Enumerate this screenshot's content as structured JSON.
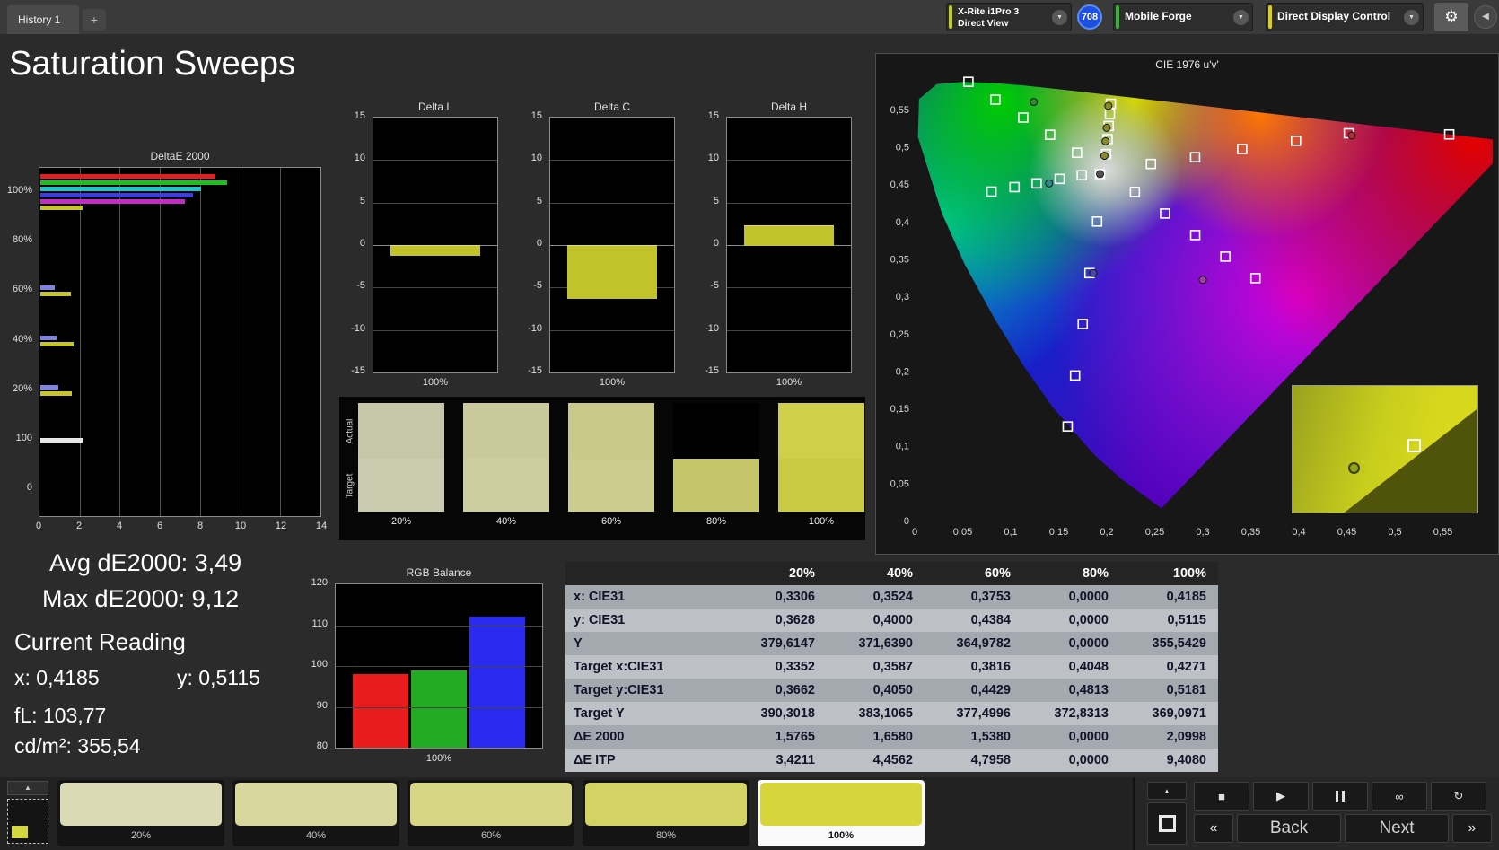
{
  "topbar": {
    "history_tab": "History 1",
    "add_tab": "+",
    "meter_line1": "X-Rite i1Pro 3",
    "meter_line2": "Direct View",
    "badge": "708",
    "source": "Mobile Forge",
    "control": "Direct Display Control"
  },
  "icons": {
    "chevron_down": "▼",
    "gear": "⚙",
    "collapse_left": "◀",
    "up": "▲",
    "stop": "■",
    "play": "▶",
    "infinity": "∞",
    "loop": "↻",
    "prev": "«",
    "next": "»"
  },
  "colors": {
    "meter_accent": "#bed41c",
    "source_accent": "#35b435",
    "control_accent": "#e0d00a"
  },
  "title": "Saturation Sweeps",
  "stats": {
    "avg": "Avg dE2000: 3,49",
    "max": "Max dE2000: 9,12",
    "current_heading": "Current Reading",
    "x": "x: 0,4185",
    "y": "y: 0,5115",
    "fl": "fL: 103,77",
    "cd": "cd/m²: 355,54"
  },
  "charts": {
    "deltae": {
      "title": "DeltaE 2000",
      "x_ticks": [
        "0",
        "2",
        "4",
        "6",
        "8",
        "10",
        "12",
        "14"
      ],
      "x_max": 14,
      "groups": [
        {
          "label": "100%",
          "bars": [
            {
              "color": "#e02020",
              "value": 8.7
            },
            {
              "color": "#1fbf1f",
              "value": 9.3
            },
            {
              "color": "#20c6c6",
              "value": 8.0
            },
            {
              "color": "#3d3de0",
              "value": 7.6
            },
            {
              "color": "#c42ac4",
              "value": 7.2
            },
            {
              "color": "#c6c62a",
              "value": 2.1
            }
          ]
        },
        {
          "label": "80%",
          "bars": []
        },
        {
          "label": "60%",
          "bars": [
            {
              "color": "#8282e6",
              "value": 0.7
            },
            {
              "color": "#c6c62a",
              "value": 1.54
            }
          ]
        },
        {
          "label": "40%",
          "bars": [
            {
              "color": "#8282e6",
              "value": 0.8
            },
            {
              "color": "#c6c62a",
              "value": 1.66
            }
          ]
        },
        {
          "label": "20%",
          "bars": [
            {
              "color": "#8282e6",
              "value": 0.9
            },
            {
              "color": "#c6c62a",
              "value": 1.58
            }
          ]
        },
        {
          "label": "100",
          "bars": [
            {
              "color": "#e8e8e8",
              "value": 2.1
            }
          ]
        },
        {
          "label": "0",
          "bars": []
        }
      ]
    },
    "delta_l": {
      "title": "Delta L",
      "y_ticks": [
        15,
        10,
        5,
        0,
        -5,
        -10,
        -15
      ],
      "x_label": "100%",
      "value": -1.2
    },
    "delta_c": {
      "title": "Delta C",
      "y_ticks": [
        15,
        10,
        5,
        0,
        -5,
        -10,
        -15
      ],
      "x_label": "100%",
      "value": -6.2
    },
    "delta_h": {
      "title": "Delta H",
      "y_ticks": [
        15,
        10,
        5,
        0,
        -5,
        -10,
        -15
      ],
      "x_label": "100%",
      "value": 2.3
    },
    "rgb": {
      "title": "RGB Balance",
      "y_min": 80,
      "y_max": 120,
      "y_ticks": [
        120,
        110,
        100,
        90,
        80
      ],
      "x_label": "100%",
      "bars": [
        {
          "name": "red",
          "color": "#e81c1c",
          "value": 98
        },
        {
          "name": "green",
          "color": "#22aa22",
          "value": 99
        },
        {
          "name": "blue",
          "color": "#2a2af0",
          "value": 112
        }
      ]
    }
  },
  "swatches": {
    "actual_label": "Actual",
    "target_label": "Target",
    "items": [
      {
        "label": "20%",
        "actual": "#c6c6a8",
        "target": "#cbcbaf"
      },
      {
        "label": "40%",
        "actual": "#c9c99b",
        "target": "#cdcda2"
      },
      {
        "label": "60%",
        "actual": "#c9c989",
        "target": "#cccc8f"
      },
      {
        "label": "80%",
        "actual": "#000000",
        "target": "#c5c56a"
      },
      {
        "label": "100%",
        "actual": "#cfcf4a",
        "target": "#c9c942"
      }
    ]
  },
  "cie": {
    "title": "CIE 1976 u'v'",
    "tick_labels": [
      "0",
      "0,05",
      "0,1",
      "0,15",
      "0,2",
      "0,25",
      "0,3",
      "0,35",
      "0,4",
      "0,45",
      "0,5",
      "0,55"
    ],
    "squares": [
      [
        0.1994,
        0.4902
      ],
      [
        0.2009,
        0.5103
      ],
      [
        0.2021,
        0.5278
      ],
      [
        0.2033,
        0.5438
      ],
      [
        0.2043,
        0.5576
      ],
      [
        0.246,
        0.477
      ],
      [
        0.292,
        0.486
      ],
      [
        0.341,
        0.497
      ],
      [
        0.397,
        0.508
      ],
      [
        0.452,
        0.518
      ],
      [
        0.5566,
        0.5165
      ],
      [
        0.169,
        0.492
      ],
      [
        0.141,
        0.516
      ],
      [
        0.113,
        0.539
      ],
      [
        0.084,
        0.563
      ],
      [
        0.056,
        0.5868
      ],
      [
        0.19,
        0.4
      ],
      [
        0.182,
        0.331
      ],
      [
        0.175,
        0.263
      ],
      [
        0.167,
        0.194
      ],
      [
        0.1593,
        0.1259
      ],
      [
        0.174,
        0.462
      ],
      [
        0.151,
        0.457
      ],
      [
        0.127,
        0.451
      ],
      [
        0.104,
        0.446
      ],
      [
        0.08,
        0.44
      ],
      [
        0.2293,
        0.4395
      ],
      [
        0.2607,
        0.4107
      ],
      [
        0.2921,
        0.3819
      ],
      [
        0.3235,
        0.3531
      ],
      [
        0.3549,
        0.3243
      ]
    ],
    "filled_square": [
      0.193,
      0.4635
    ],
    "dots": [
      {
        "u": 0.1976,
        "v": 0.4879,
        "c": "#8a8a2a"
      },
      {
        "u": 0.1987,
        "v": 0.5074,
        "c": "#8a8a2a"
      },
      {
        "u": 0.1999,
        "v": 0.5253,
        "c": "#8a8a2a"
      },
      {
        "u": 0.2017,
        "v": 0.5546,
        "c": "#8a8a2a"
      },
      {
        "u": 0.124,
        "v": 0.56,
        "c": "#2d8a2d"
      },
      {
        "u": 0.14,
        "v": 0.451,
        "c": "#2d8a8a"
      },
      {
        "u": 0.186,
        "v": 0.331,
        "c": "#4747ad"
      },
      {
        "u": 0.3,
        "v": 0.322,
        "c": "#a040a0"
      },
      {
        "u": 0.455,
        "v": 0.515,
        "c": "#b03030"
      },
      {
        "u": 0.193,
        "v": 0.4635,
        "c": "#555555"
      }
    ],
    "inset": {
      "square_left": "62%",
      "square_top": "42%",
      "dot_left": "30%",
      "dot_top": "60%"
    }
  },
  "table": {
    "columns": [
      "",
      "20%",
      "40%",
      "60%",
      "80%",
      "100%"
    ],
    "rows": [
      {
        "label": "x: CIE31",
        "values": [
          "0,3306",
          "0,3524",
          "0,3753",
          "0,0000",
          "0,4185"
        ]
      },
      {
        "label": "y: CIE31",
        "values": [
          "0,3628",
          "0,4000",
          "0,4384",
          "0,0000",
          "0,5115"
        ]
      },
      {
        "label": "Y",
        "values": [
          "379,6147",
          "371,6390",
          "364,9782",
          "0,0000",
          "355,5429"
        ]
      },
      {
        "label": "Target x:CIE31",
        "values": [
          "0,3352",
          "0,3587",
          "0,3816",
          "0,4048",
          "0,4271"
        ]
      },
      {
        "label": "Target y:CIE31",
        "values": [
          "0,3662",
          "0,4050",
          "0,4429",
          "0,4813",
          "0,5181"
        ]
      },
      {
        "label": "Target Y",
        "values": [
          "390,3018",
          "383,1065",
          "377,4996",
          "372,8313",
          "369,0971"
        ]
      },
      {
        "label": "ΔE 2000",
        "values": [
          "1,5765",
          "1,6580",
          "1,5380",
          "0,0000",
          "2,0998"
        ]
      },
      {
        "label": "ΔE ITP",
        "values": [
          "3,4211",
          "4,4562",
          "4,7958",
          "0,0000",
          "9,4080"
        ]
      }
    ]
  },
  "bottom": {
    "patches": [
      {
        "label": "20%",
        "color": "#dadbb4",
        "selected": false
      },
      {
        "label": "40%",
        "color": "#d8d89e",
        "selected": false
      },
      {
        "label": "60%",
        "color": "#d6d685",
        "selected": false
      },
      {
        "label": "80%",
        "color": "#d3d364",
        "selected": false
      },
      {
        "label": "100%",
        "color": "#d6d63c",
        "selected": true
      }
    ],
    "back": "Back",
    "next": "Next"
  }
}
